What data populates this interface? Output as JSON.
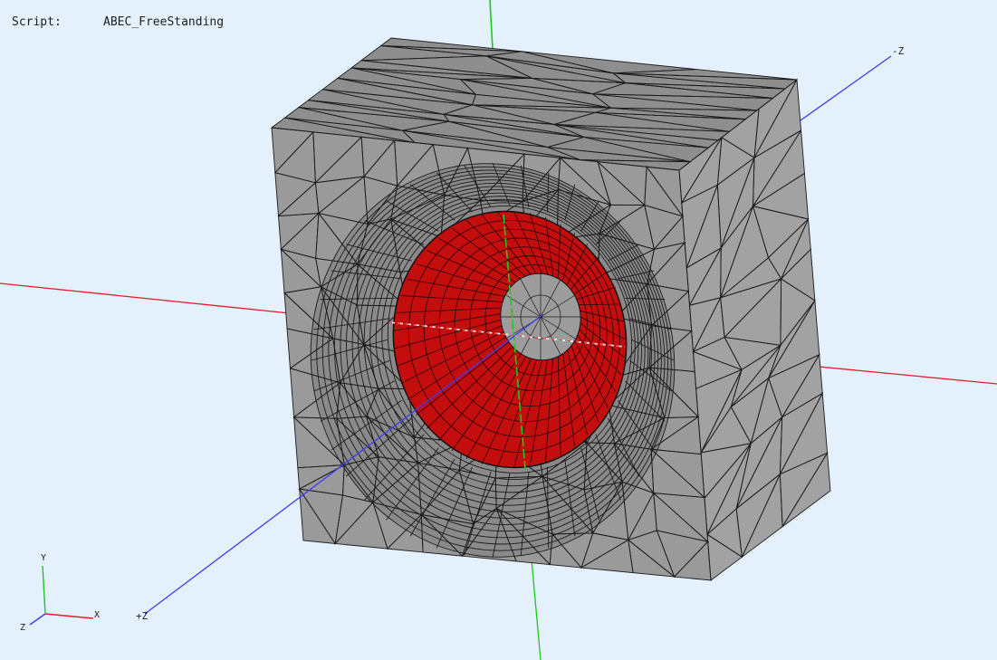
{
  "script": {
    "label": "Script:",
    "name": "ABEC_FreeStanding"
  },
  "axes": {
    "neg_z_label": "-Z",
    "pos_z_label": "+Z"
  },
  "triad": {
    "y_label": "Y",
    "x_label": "X",
    "z_label": "Z"
  },
  "colors": {
    "background": "#e4f0fc",
    "box_front": "#9a9a9a",
    "box_top": "#8e8e8e",
    "box_side": "#a2a2a2",
    "driver_cone": "#c40e0e",
    "x_axis": "#e0202a",
    "y_axis": "#1ec81e",
    "z_axis": "#3c3cf0"
  }
}
